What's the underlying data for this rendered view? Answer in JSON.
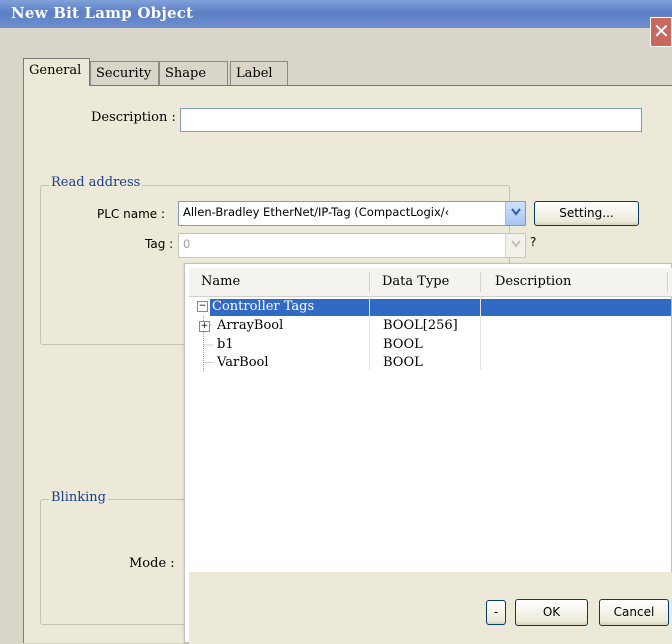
{
  "window": {
    "title": "New  Bit Lamp Object",
    "close_symbol": "✕"
  },
  "tabs": [
    {
      "label": "General",
      "active": true
    },
    {
      "label": "Security",
      "active": false
    },
    {
      "label": "Shape",
      "active": false
    },
    {
      "label": "Label",
      "active": false
    }
  ],
  "general": {
    "description_label": "Description :",
    "description_value": ""
  },
  "read_address": {
    "group_title": "Read address",
    "plc_name_label": "PLC name :",
    "plc_name_value": "Allen-Bradley EtherNet/IP-Tag (CompactLogix/‹",
    "setting_button": "Setting...",
    "tag_label": "Tag :",
    "tag_value": "0",
    "tag_extra": "?"
  },
  "blinking": {
    "group_title": "Blinking",
    "mode_label": "Mode :"
  },
  "tag_browser": {
    "columns": [
      "Name",
      "Data Type",
      "Description"
    ],
    "root": {
      "name": "Controller Tags",
      "expander": "−"
    },
    "rows": [
      {
        "name": "ArrayBool",
        "type": "BOOL[256]",
        "description": "",
        "expander": "+"
      },
      {
        "name": "b1",
        "type": "BOOL",
        "description": ""
      },
      {
        "name": "VarBool",
        "type": "BOOL",
        "description": ""
      }
    ],
    "minus_button": "-",
    "ok_button": "OK",
    "cancel_button": "Cancel"
  },
  "colors": {
    "title_bar": "#6a8ad0",
    "selection": "#316ac5",
    "group_title": "#1b3d8f",
    "close_button": "#c9685f"
  }
}
